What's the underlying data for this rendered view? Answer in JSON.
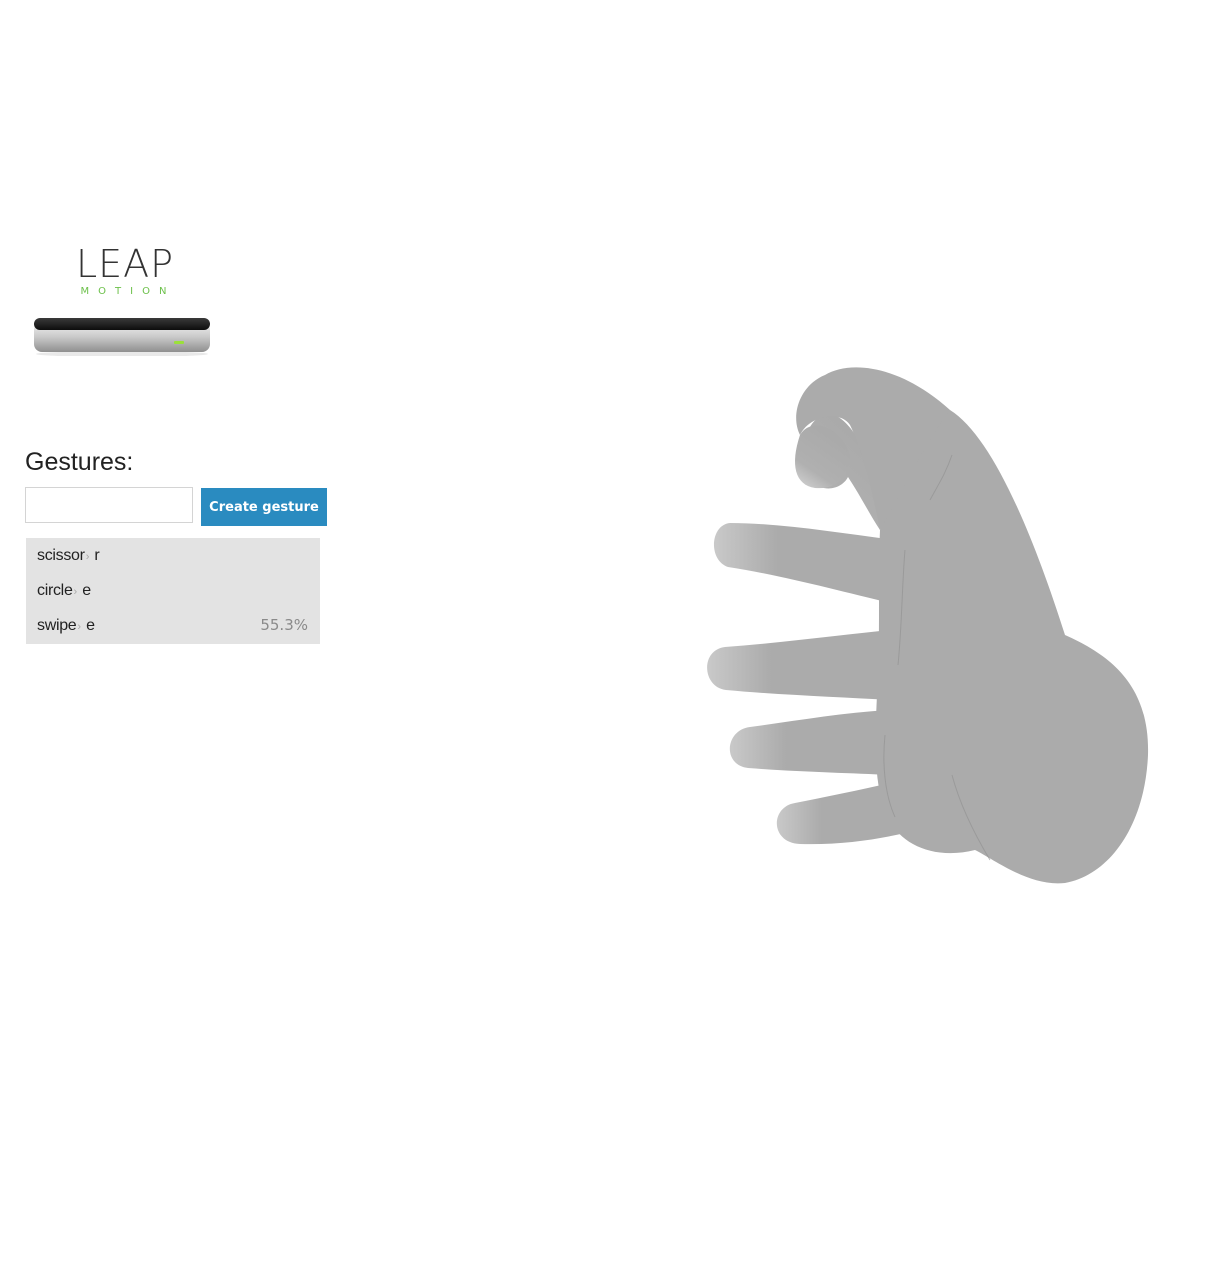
{
  "logo": {
    "wordmark": "LEAP",
    "subtitle": "MOTION",
    "accent_color": "#6cc04a"
  },
  "gestures": {
    "title": "Gestures:",
    "input": {
      "value": "",
      "placeholder": ""
    },
    "create_button_label": "Create gesture",
    "button_color": "#2a8bc0",
    "items": [
      {
        "name": "scissor",
        "key": "r",
        "confidence": ""
      },
      {
        "name": "circle",
        "key": "e",
        "confidence": ""
      },
      {
        "name": "swipe",
        "key": "e",
        "confidence": "55.3%"
      }
    ]
  },
  "hand_render": {
    "color": "#aaaaaa",
    "icon": "hand-model"
  }
}
